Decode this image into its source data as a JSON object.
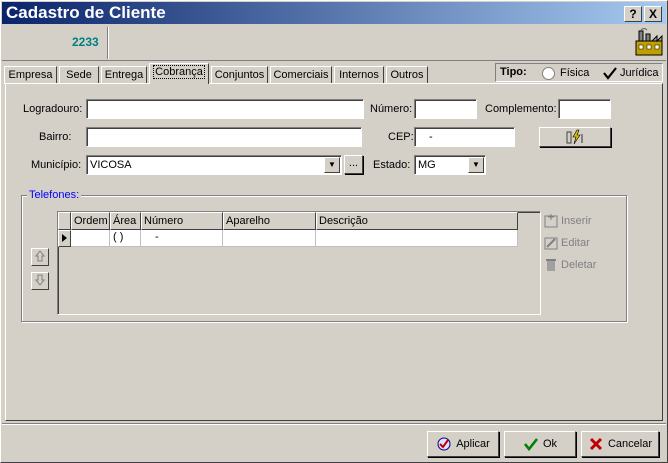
{
  "window": {
    "title": "Cadastro de Cliente",
    "help_button": "?",
    "close_button": "X"
  },
  "header": {
    "code": "2233"
  },
  "tabs": [
    {
      "label": "Empresa",
      "active": false
    },
    {
      "label": "Sede",
      "active": false
    },
    {
      "label": "Entrega",
      "active": false
    },
    {
      "label": "Cobrança",
      "active": true
    },
    {
      "label": "Conjuntos",
      "active": false
    },
    {
      "label": "Comerciais",
      "active": false
    },
    {
      "label": "Internos",
      "active": false
    },
    {
      "label": "Outros",
      "active": false
    }
  ],
  "tipo": {
    "label": "Tipo:",
    "options": [
      {
        "label": "Física",
        "selected": false
      },
      {
        "label": "Jurídica",
        "selected": true
      }
    ]
  },
  "form": {
    "logradouro_label": "Logradouro:",
    "logradouro_value": "",
    "numero_label": "Número:",
    "numero_value": "",
    "complemento_label": "Complemento:",
    "complemento_value": "",
    "bairro_label": "Bairro:",
    "bairro_value": "",
    "cep_label": "CEP:",
    "cep_value": "-",
    "municipio_label": "Município:",
    "municipio_value": "VICOSA",
    "ellipsis_label": "...",
    "estado_label": "Estado:",
    "estado_value": "MG"
  },
  "telefones": {
    "title": "Telefones:",
    "columns": [
      "Ordem",
      "Área",
      "Número",
      "Aparelho",
      "Descrição"
    ],
    "rows": [
      {
        "ordem": "",
        "area": "( )",
        "numero": "-",
        "aparelho": "",
        "descricao": ""
      }
    ],
    "inserir_label": "Inserir",
    "editar_label": "Editar",
    "deletar_label": "Deletar"
  },
  "footer": {
    "aplicar_label": "Aplicar",
    "ok_label": "Ok",
    "cancelar_label": "Cancelar"
  },
  "colors": {
    "title_bar": "#0a246a",
    "code_text": "#008080",
    "group_title": "#0000ff",
    "ok_check": "#008000",
    "cancel_x": "#c00000"
  },
  "icons": {
    "factory": "factory-icon",
    "cep_search": "lightning-icon",
    "up": "arrow-up-icon",
    "down": "arrow-down-icon"
  }
}
